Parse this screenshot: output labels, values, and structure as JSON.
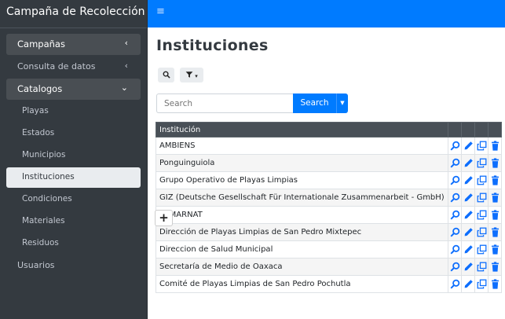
{
  "app": {
    "title": "Campaña de Recolección"
  },
  "sidebar": {
    "items": [
      {
        "label": "Campañas",
        "chevron": "‹"
      },
      {
        "label": "Consulta de datos",
        "chevron": "‹"
      },
      {
        "label": "Catalogos",
        "chevron": "⌄"
      }
    ],
    "sub_items": [
      "Playas",
      "Estados",
      "Municipios",
      "Instituciones",
      "Condiciones",
      "Materiales",
      "Residuos"
    ],
    "last_item": "Usuarios"
  },
  "header": {
    "menu_icon": "≡"
  },
  "page": {
    "title": "Instituciones"
  },
  "search": {
    "placeholder": "Search",
    "button_label": "Search"
  },
  "table": {
    "header": "Institución",
    "rows": [
      "AMBIENS",
      "Ponguinguiola",
      "Grupo Operativo de Playas Limpias",
      "GIZ (Deutsche Gesellschaft Für Internationale Zusammenarbeit - GmbH)",
      "SEMARNAT",
      "Dirección de Playas Limpias de San Pedro Mixtepec",
      "Direccion de Salud Municipal",
      "Secretaría de Medio de Oaxaca",
      "Comité de Playas Limpias de San Pedro Pochutla"
    ],
    "add_label": "+"
  },
  "colors": {
    "brand": "#007bff",
    "sidebar": "#343a40",
    "action_icon": "#0d6efd"
  }
}
